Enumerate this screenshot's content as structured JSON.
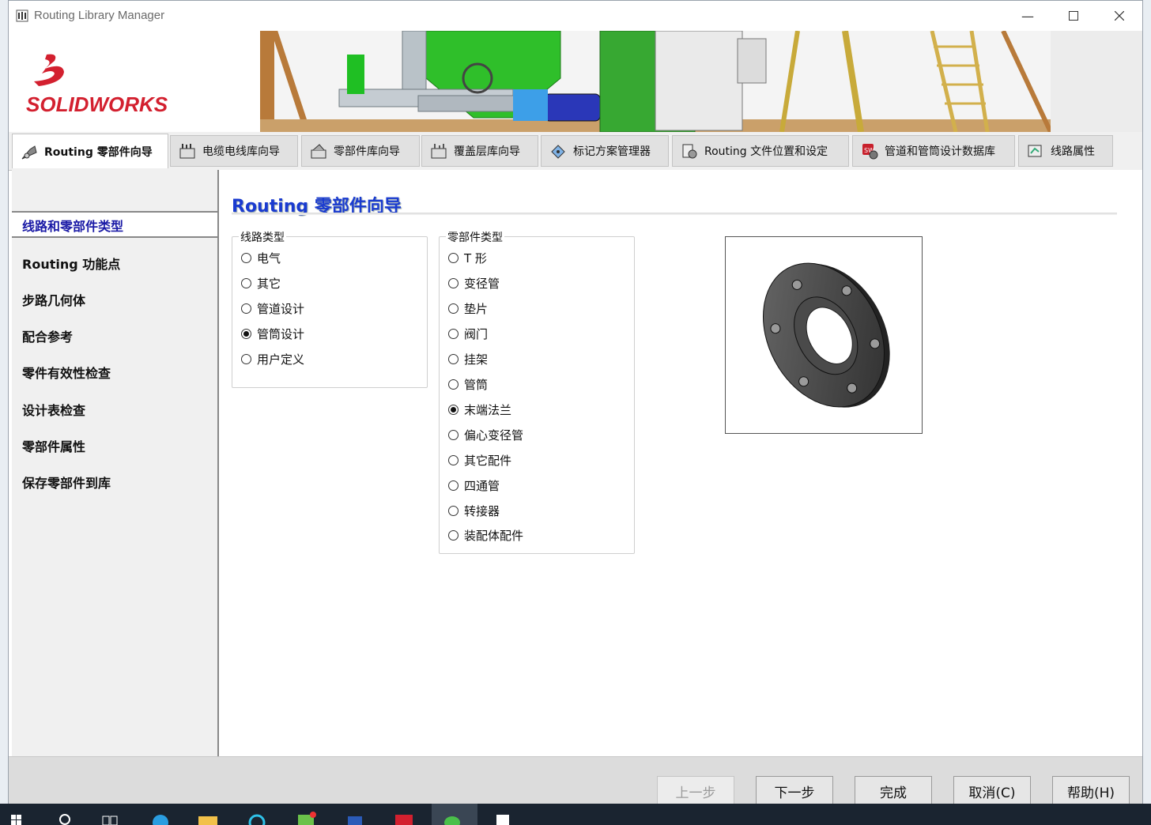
{
  "window": {
    "title": "Routing Library Manager"
  },
  "brand": {
    "logo_text": "SOLIDWORKS"
  },
  "tabs": [
    {
      "label": "Routing 零部件向导",
      "icon": "wizard-icon"
    },
    {
      "label": "电缆电线库向导",
      "icon": "cable-library-icon"
    },
    {
      "label": "零部件库向导",
      "icon": "component-library-icon"
    },
    {
      "label": "覆盖层库向导",
      "icon": "covering-library-icon"
    },
    {
      "label": "标记方案管理器",
      "icon": "tag-scheme-icon"
    },
    {
      "label": "Routing 文件位置和设定",
      "icon": "file-settings-icon"
    },
    {
      "label": "管道和管筒设计数据库",
      "icon": "database-icon"
    },
    {
      "label": "线路属性",
      "icon": "route-properties-icon"
    }
  ],
  "nav": {
    "items": [
      "线路和零部件类型",
      "Routing 功能点",
      "步路几何体",
      "配合参考",
      "零件有效性检查",
      "设计表检查",
      "零部件属性",
      "保存零部件到库"
    ]
  },
  "page": {
    "title": "Routing 零部件向导"
  },
  "route_type": {
    "label": "线路类型",
    "options": [
      "电气",
      "其它",
      "管道设计",
      "管筒设计",
      "用户定义"
    ],
    "selected": "管筒设计"
  },
  "component_type": {
    "label": "零部件类型",
    "options": [
      "T 形",
      "变径管",
      "垫片",
      "阀门",
      "挂架",
      "管筒",
      "末端法兰",
      "偏心变径管",
      "其它配件",
      "四通管",
      "转接器",
      "装配体配件"
    ],
    "selected": "末端法兰"
  },
  "preview": {
    "icon": "flange-preview-image"
  },
  "buttons": {
    "back": "上一步",
    "next": "下一步",
    "finish": "完成",
    "cancel": "取消(C)",
    "help": "帮助(H)"
  },
  "colors": {
    "accent": "#1a3bd0",
    "nav_active": "#1a1aa6"
  }
}
